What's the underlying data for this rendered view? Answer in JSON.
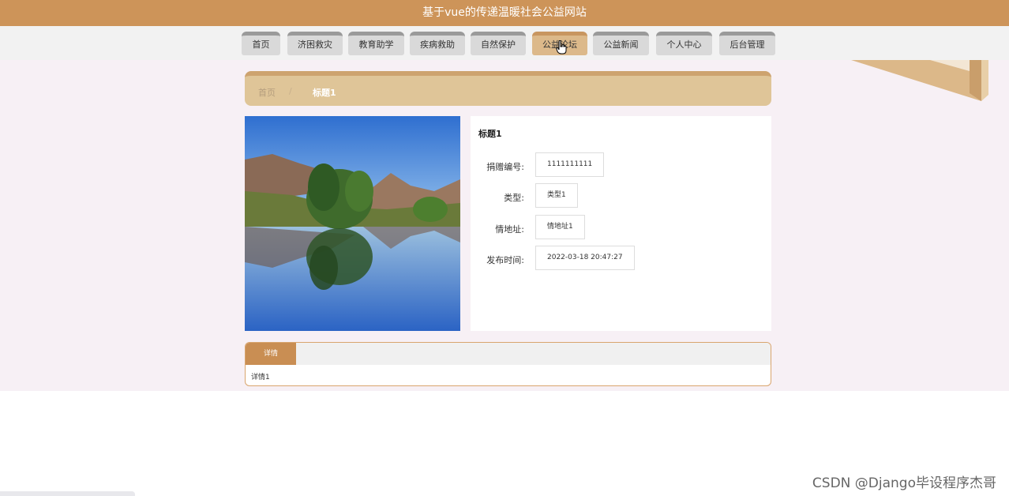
{
  "site": {
    "title": "基于vue的传递温暖社会公益网站"
  },
  "nav": {
    "items": [
      {
        "label": "首页"
      },
      {
        "label": "济困救灾"
      },
      {
        "label": "教育助学"
      },
      {
        "label": "疾病救助"
      },
      {
        "label": "自然保护"
      },
      {
        "label": "公益论坛"
      },
      {
        "label": "公益新闻"
      },
      {
        "label": "个人中心"
      },
      {
        "label": "后台管理"
      }
    ],
    "active": "公益论坛"
  },
  "breadcrumb": {
    "home": "首页",
    "separator": "/",
    "current": "标题1"
  },
  "detail": {
    "title": "标题1",
    "fields": [
      {
        "label": "捐赠编号:",
        "value": "1111111111"
      },
      {
        "label": "类型:",
        "value": "类型1"
      },
      {
        "label": "情地址:",
        "value": "情地址1"
      },
      {
        "label": "发布时间:",
        "value": "2022-03-18 20:47:27"
      }
    ]
  },
  "tabs": {
    "active_label": "详情",
    "content": "详情1"
  },
  "watermark": "CSDN @Django毕设程序杰哥",
  "colors": {
    "header": "#cd9459",
    "accent": "#c98e53",
    "breadcrumb": "#dfc598"
  }
}
